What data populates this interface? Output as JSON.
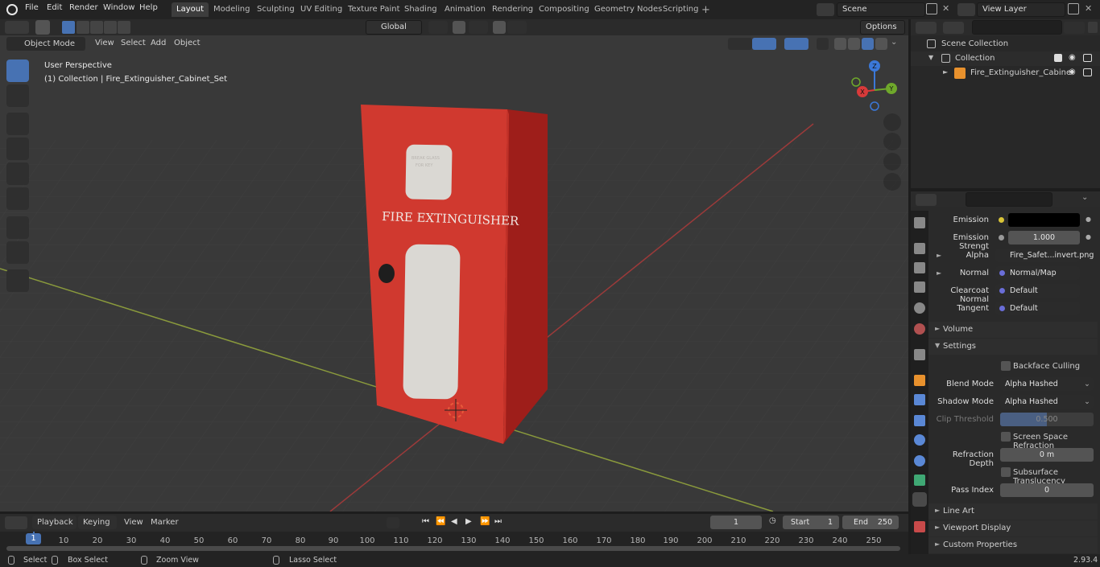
{
  "topbar": {
    "menus": [
      "File",
      "Edit",
      "Render",
      "Window",
      "Help"
    ],
    "workspaces": [
      "Layout",
      "Modeling",
      "Sculpting",
      "UV Editing",
      "Texture Paint",
      "Shading",
      "Animation",
      "Rendering",
      "Compositing",
      "Geometry Nodes",
      "Scripting"
    ],
    "active_workspace": "Layout",
    "scene": "Scene",
    "view_layer": "View Layer"
  },
  "viewport": {
    "mode": "Object Mode",
    "menus": [
      "View",
      "Select",
      "Add",
      "Object"
    ],
    "orientation": "Global",
    "options": "Options",
    "perspective_label": "User Perspective",
    "collection_label": "(1) Collection | Fire_Extinguisher_Cabinet_Set",
    "cabinet_title": "FIRE EXTINGUISHER",
    "cabinet_small_text_1": "BREAK GLASS",
    "cabinet_small_text_2": "FOR KEY",
    "gizmo_axes": {
      "x": "X",
      "y": "Y",
      "z": "Z"
    }
  },
  "outliner": {
    "root": "Scene Collection",
    "collection": "Collection",
    "object": "Fire_Extinguisher_Cabine"
  },
  "properties": {
    "rows": [
      {
        "label": "Emission",
        "value": "",
        "kind": "color"
      },
      {
        "label": "Emission Strengt",
        "value": "1.000",
        "kind": "slider"
      },
      {
        "label": "Alpha",
        "value": "Fire_Safet...invert.png",
        "kind": "link"
      },
      {
        "label": "Normal",
        "value": "Normal/Map",
        "kind": "link"
      },
      {
        "label": "Clearcoat Normal",
        "value": "Default",
        "kind": "link"
      },
      {
        "label": "Tangent",
        "value": "Default",
        "kind": "link"
      }
    ],
    "volume": "Volume",
    "settings": "Settings",
    "backface_culling": "Backface Culling",
    "blend_mode_label": "Blend Mode",
    "blend_mode": "Alpha Hashed",
    "shadow_mode_label": "Shadow Mode",
    "shadow_mode": "Alpha Hashed",
    "clip_threshold_label": "Clip Threshold",
    "clip_threshold": "0.500",
    "screen_space_refraction": "Screen Space Refraction",
    "refraction_depth_label": "Refraction Depth",
    "refraction_depth": "0 m",
    "subsurface_translucency": "Subsurface Translucency",
    "pass_index_label": "Pass Index",
    "pass_index": "0",
    "line_art": "Line Art",
    "viewport_display": "Viewport Display",
    "custom_properties": "Custom Properties"
  },
  "timeline": {
    "menus": [
      "Playback",
      "Keying",
      "View",
      "Marker"
    ],
    "current_frame": "1",
    "start_label": "Start",
    "start": "1",
    "end_label": "End",
    "end": "250",
    "ticks": [
      "1",
      "10",
      "20",
      "30",
      "40",
      "50",
      "60",
      "70",
      "80",
      "90",
      "100",
      "110",
      "120",
      "130",
      "140",
      "150",
      "160",
      "170",
      "180",
      "190",
      "200",
      "210",
      "220",
      "230",
      "240",
      "250"
    ]
  },
  "status": {
    "select": "Select",
    "box_select": "Box Select",
    "zoom_view": "Zoom View",
    "lasso_select": "Lasso Select",
    "version": "2.93.4"
  }
}
